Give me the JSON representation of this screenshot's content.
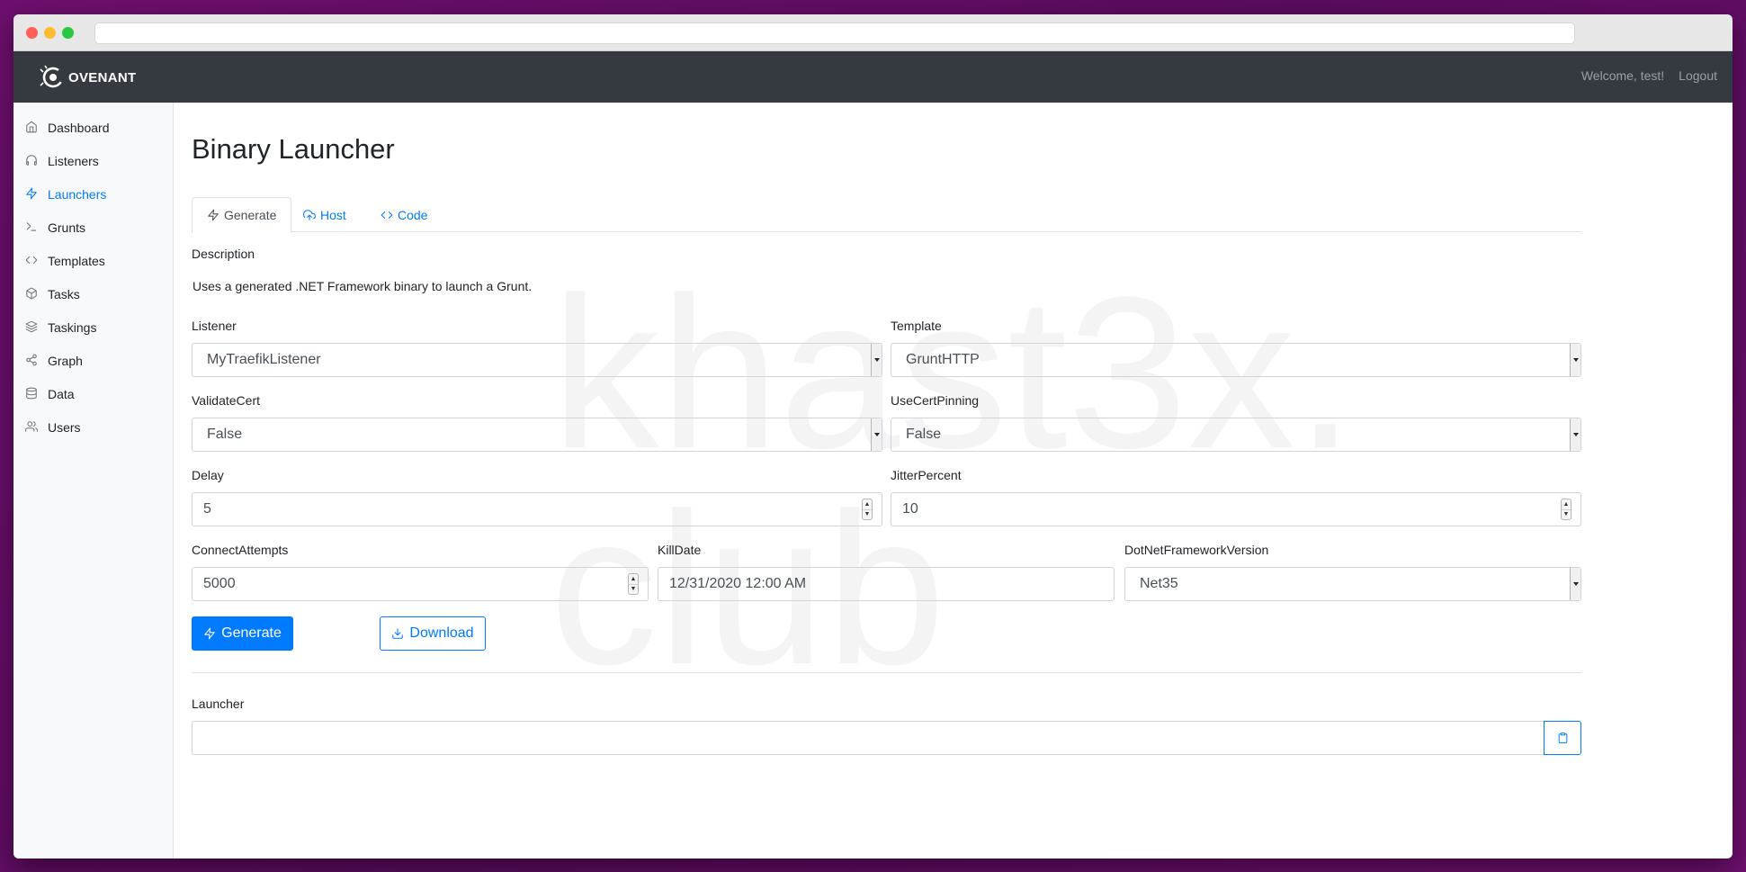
{
  "header": {
    "brand": "OVENANT",
    "welcome": "Welcome, test!",
    "logout": "Logout"
  },
  "sidebar": {
    "items": [
      {
        "label": "Dashboard",
        "icon": "home-icon"
      },
      {
        "label": "Listeners",
        "icon": "headphones-icon"
      },
      {
        "label": "Launchers",
        "icon": "zap-icon",
        "active": true
      },
      {
        "label": "Grunts",
        "icon": "terminal-icon"
      },
      {
        "label": "Templates",
        "icon": "code-icon"
      },
      {
        "label": "Tasks",
        "icon": "box-icon"
      },
      {
        "label": "Taskings",
        "icon": "layers-icon"
      },
      {
        "label": "Graph",
        "icon": "share-icon"
      },
      {
        "label": "Data",
        "icon": "database-icon"
      },
      {
        "label": "Users",
        "icon": "users-icon"
      }
    ]
  },
  "main": {
    "title": "Binary Launcher",
    "watermark_line1": "khast3x.",
    "watermark_line2": "club",
    "tabs": [
      {
        "label": "Generate",
        "icon": "zap-icon",
        "active": true
      },
      {
        "label": "Host",
        "icon": "cloud-upload-icon"
      },
      {
        "label": "Code",
        "icon": "code-icon"
      }
    ],
    "description_label": "Description",
    "description_text": "Uses a generated .NET Framework binary to launch a Grunt.",
    "form": {
      "listener": {
        "label": "Listener",
        "value": "MyTraefikListener"
      },
      "template": {
        "label": "Template",
        "value": "GruntHTTP"
      },
      "validate_cert": {
        "label": "ValidateCert",
        "value": "False"
      },
      "use_cert_pinning": {
        "label": "UseCertPinning",
        "value": "False"
      },
      "delay": {
        "label": "Delay",
        "value": "5"
      },
      "jitter_percent": {
        "label": "JitterPercent",
        "value": "10"
      },
      "connect_attempts": {
        "label": "ConnectAttempts",
        "value": "5000"
      },
      "kill_date": {
        "label": "KillDate",
        "value": "12/31/2020 12:00 AM"
      },
      "dotnet_version": {
        "label": "DotNetFrameworkVersion",
        "value": "Net35"
      }
    },
    "buttons": {
      "generate": "Generate",
      "download": "Download"
    },
    "launcher": {
      "label": "Launcher",
      "value": ""
    }
  },
  "colors": {
    "primary": "#007bff",
    "navbar": "#343a40",
    "sidebar": "#f8f9fa",
    "background": "#6e0f6e"
  }
}
